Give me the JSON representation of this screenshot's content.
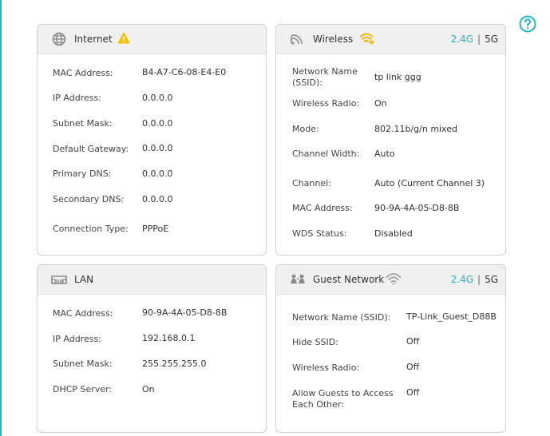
{
  "colors": {
    "accent": "#21b6c4",
    "warning": "#f5c200",
    "wifi_warn": "#f5b300"
  },
  "help_icon": "question-circle-icon",
  "internet": {
    "title": "Internet",
    "rows": [
      {
        "label": "MAC Address:",
        "value": "B4-A7-C6-08-E4-E0"
      },
      {
        "label": "IP Address:",
        "value": "0.0.0.0"
      },
      {
        "label": "Subnet Mask:",
        "value": "0.0.0.0"
      },
      {
        "label": "Default Gateway:",
        "value": "0.0.0.0"
      },
      {
        "label": "Primary DNS:",
        "value": "0.0.0.0"
      },
      {
        "label": "Secondary DNS:",
        "value": "0.0.0.0"
      },
      {
        "label": "Connection Type:",
        "value": "PPPoE"
      }
    ]
  },
  "wireless": {
    "title": "Wireless",
    "band_selected": "2.4G",
    "band_separator": "|",
    "band_other": "5G",
    "rows": [
      {
        "label": "Network Name (SSID):",
        "value": "tp link ggg"
      },
      {
        "label": "Wireless Radio:",
        "value": "On"
      },
      {
        "label": "Mode:",
        "value": "802.11b/g/n mixed"
      },
      {
        "label": "Channel Width:",
        "value": "Auto"
      },
      {
        "label": "Channel:",
        "value": "Auto (Current Channel 3)"
      },
      {
        "label": "MAC Address:",
        "value": "90-9A-4A-05-D8-8B"
      },
      {
        "label": "WDS Status:",
        "value": "Disabled"
      }
    ]
  },
  "lan": {
    "title": "LAN",
    "rows": [
      {
        "label": "MAC Address:",
        "value": "90-9A-4A-05-D8-8B"
      },
      {
        "label": "IP Address:",
        "value": "192.168.0.1"
      },
      {
        "label": "Subnet Mask:",
        "value": "255.255.255.0"
      },
      {
        "label": "DHCP Server:",
        "value": "On"
      }
    ]
  },
  "guest": {
    "title": "Guest Network",
    "band_selected": "2.4G",
    "band_separator": "|",
    "band_other": "5G",
    "rows": [
      {
        "label": "Network Name (SSID):",
        "value": "TP-Link_Guest_D88B"
      },
      {
        "label": "Hide SSID:",
        "value": "Off"
      },
      {
        "label": "Wireless Radio:",
        "value": "Off"
      },
      {
        "label": "Allow Guests to Access Each Other:",
        "value": "Off"
      }
    ]
  }
}
